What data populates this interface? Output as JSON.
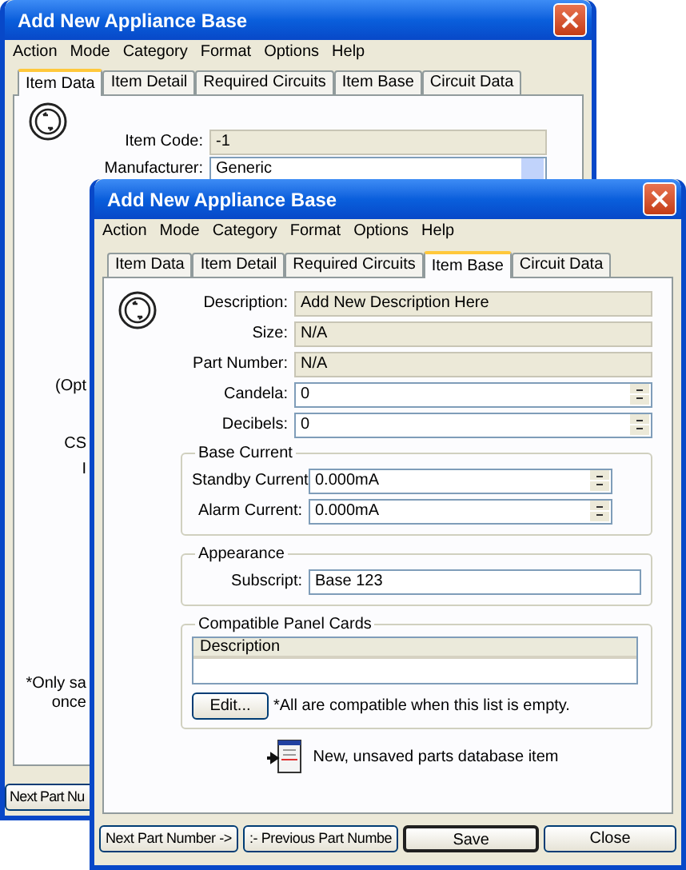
{
  "back_window": {
    "title": "Add New Appliance Base",
    "menu": [
      "Action",
      "Mode",
      "Category",
      "Format",
      "Options",
      "Help"
    ],
    "tabs": [
      {
        "label": "Item Data",
        "selected": true
      },
      {
        "label": "Item Detail",
        "selected": false
      },
      {
        "label": "Required Circuits",
        "selected": false
      },
      {
        "label": "Item Base",
        "selected": false
      },
      {
        "label": "Circuit Data",
        "selected": false
      }
    ],
    "fields": [
      {
        "label": "Item Code:",
        "value": "-1",
        "kind": "readonly"
      },
      {
        "label": "Manufacturer:",
        "value": "Generic",
        "kind": "dropdown"
      }
    ],
    "cut_labels": [
      "(Opt",
      "CS",
      "I"
    ],
    "note_lines": [
      "*Only sa",
      "once"
    ],
    "button": "Next Part Nu"
  },
  "front_window": {
    "title": "Add New Appliance Base",
    "menu": [
      "Action",
      "Mode",
      "Category",
      "Format",
      "Options",
      "Help"
    ],
    "tabs": [
      {
        "label": "Item Data",
        "selected": false
      },
      {
        "label": "Item Detail",
        "selected": false
      },
      {
        "label": "Required Circuits",
        "selected": false
      },
      {
        "label": "Item Base",
        "selected": true
      },
      {
        "label": "Circuit Data",
        "selected": false
      }
    ],
    "fields": [
      {
        "label": "Description:",
        "value": "Add New Description Here",
        "kind": "readonly"
      },
      {
        "label": "Size:",
        "value": "N/A",
        "kind": "readonly"
      },
      {
        "label": "Part Number:",
        "value": "N/A",
        "kind": "readonly"
      },
      {
        "label": "Candela:",
        "value": "0",
        "kind": "spin"
      },
      {
        "label": "Decibels:",
        "value": "0",
        "kind": "spin"
      }
    ],
    "base_current": {
      "title": "Base Current",
      "fields": [
        {
          "label": "Standby Current:",
          "value": "0.000mA",
          "kind": "spin"
        },
        {
          "label": "Alarm Current:",
          "value": "0.000mA",
          "kind": "spin"
        }
      ]
    },
    "appearance": {
      "title": "Appearance",
      "fields": [
        {
          "label": "Subscript:",
          "value": "Base 123",
          "kind": "text"
        }
      ]
    },
    "panel_cards": {
      "title": "Compatible Panel Cards",
      "columns": [
        "Description"
      ],
      "edit_button": "Edit...",
      "note": "*All are compatible when this list is empty."
    },
    "status": "New, unsaved parts database item",
    "buttons": [
      {
        "label": "Next Part Number ->",
        "default": false
      },
      {
        "label": ":- Previous Part Numbe",
        "default": false
      },
      {
        "label": "Save",
        "default": true
      },
      {
        "label": "Close",
        "default": false
      }
    ]
  }
}
